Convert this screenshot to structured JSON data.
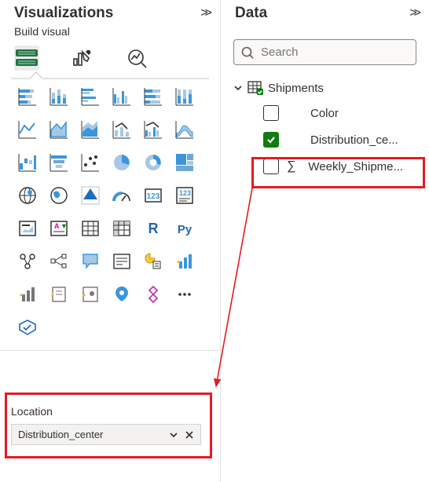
{
  "viz": {
    "title": "Visualizations",
    "subtitle": "Build visual",
    "field_well_label": "Location",
    "field_item": "Distribution_center"
  },
  "data": {
    "title": "Data",
    "search_placeholder": "Search",
    "table": "Shipments",
    "fields": {
      "color": "Color",
      "dist": "Distribution_ce...",
      "weekly": "Weekly_Shipme..."
    }
  }
}
